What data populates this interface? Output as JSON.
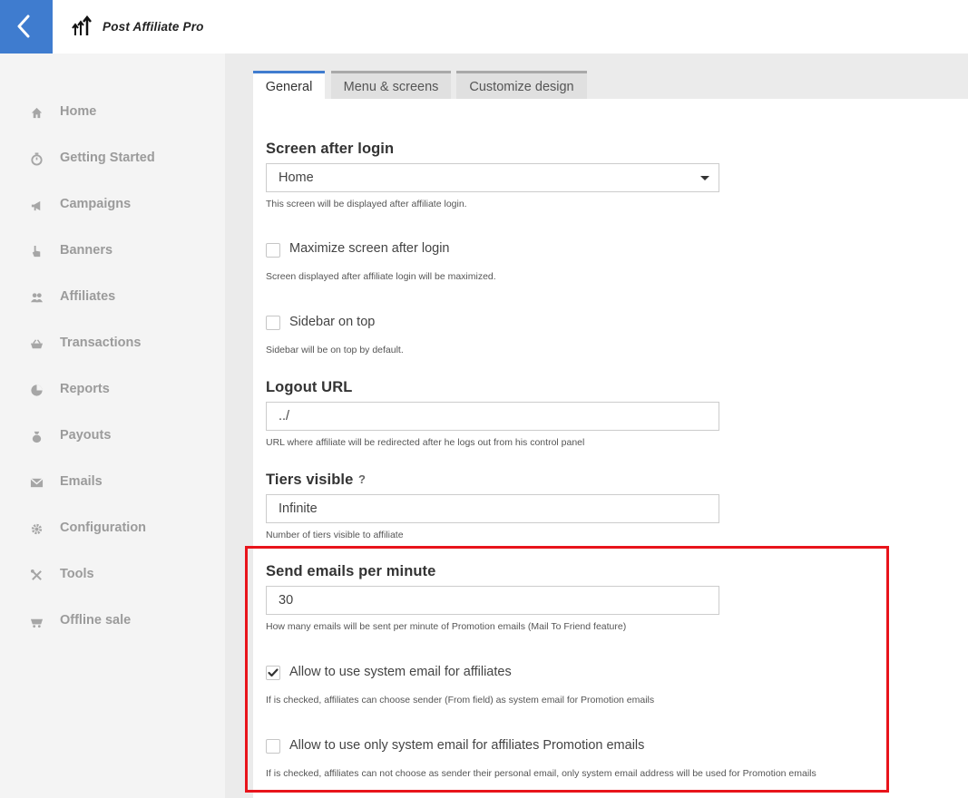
{
  "header": {
    "back_icon": "chevron-left-icon",
    "logo_icon": "arrows-up-icon",
    "app_title": "Post Affiliate Pro",
    "accent_color": "#3f7ccf"
  },
  "sidebar": {
    "items": [
      {
        "label": "Home",
        "icon": "home-icon"
      },
      {
        "label": "Getting Started",
        "icon": "stopwatch-icon"
      },
      {
        "label": "Campaigns",
        "icon": "megaphone-icon"
      },
      {
        "label": "Banners",
        "icon": "hand-pointer-icon"
      },
      {
        "label": "Affiliates",
        "icon": "users-icon"
      },
      {
        "label": "Transactions",
        "icon": "basket-icon"
      },
      {
        "label": "Reports",
        "icon": "pie-chart-icon"
      },
      {
        "label": "Payouts",
        "icon": "money-bag-icon"
      },
      {
        "label": "Emails",
        "icon": "envelope-icon"
      },
      {
        "label": "Configuration",
        "icon": "gear-icon"
      },
      {
        "label": "Tools",
        "icon": "tools-icon"
      },
      {
        "label": "Offline sale",
        "icon": "cart-icon"
      }
    ]
  },
  "tabs": [
    {
      "label": "General",
      "active": true
    },
    {
      "label": "Menu & screens",
      "active": false
    },
    {
      "label": "Customize design",
      "active": false
    }
  ],
  "form": {
    "screen_after_login": {
      "label": "Screen after login",
      "value": "Home",
      "hint": "This screen will be displayed after affiliate login."
    },
    "maximize_screen": {
      "label": "Maximize screen after login",
      "checked": false,
      "hint": "Screen displayed after affiliate login will be maximized."
    },
    "sidebar_on_top": {
      "label": "Sidebar on top",
      "checked": false,
      "hint": "Sidebar will be on top by default."
    },
    "logout_url": {
      "label": "Logout URL",
      "value": "../",
      "hint": "URL where affiliate will be redirected after he logs out from his control panel"
    },
    "tiers_visible": {
      "label": "Tiers visible",
      "help": "?",
      "value": "Infinite",
      "hint": "Number of tiers visible to affiliate"
    },
    "send_emails_per_minute": {
      "label": "Send emails per minute",
      "value": "30",
      "hint": "How many emails will be sent per minute of Promotion emails (Mail To Friend feature)"
    },
    "allow_system_email": {
      "label": "Allow to use system email for affiliates",
      "checked": true,
      "hint": "If is checked, affiliates can choose sender (From field) as system email for Promotion emails"
    },
    "allow_only_system_email": {
      "label": "Allow to use only system email for affiliates Promotion emails",
      "checked": false,
      "hint": "If is checked, affiliates can not choose as sender their personal email, only system email address will be used for Promotion emails"
    }
  },
  "highlight_color": "#e8141b"
}
